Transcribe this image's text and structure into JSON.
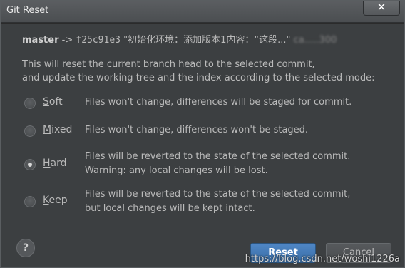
{
  "window": {
    "title": "Git Reset",
    "close_glyph": "✕"
  },
  "commit": {
    "branch": "master",
    "arrow": "->",
    "hash": "f25c91e3",
    "message": "\"初始化环境：添加版本1内容：“这段...\"",
    "blurred_tail": "ca.....300"
  },
  "description": {
    "line1": "This will reset the current branch head to the selected commit,",
    "line2": "and update the working tree and the index according to the selected mode:"
  },
  "modes": [
    {
      "mnemonic": "S",
      "rest": "oft",
      "line1": "Files won't change, differences will be staged for commit.",
      "line2": "",
      "selected": false
    },
    {
      "mnemonic": "M",
      "rest": "ixed",
      "line1": "Files won't change, differences won't be staged.",
      "line2": "",
      "selected": false
    },
    {
      "mnemonic": "H",
      "rest": "ard",
      "line1": "Files will be reverted to the state of the selected commit.",
      "line2": "Warning: any local changes will be lost.",
      "selected": true
    },
    {
      "mnemonic": "K",
      "rest": "eep",
      "line1": "Files will be reverted to the state of the selected commit,",
      "line2": "but local changes will be kept intact.",
      "selected": false
    }
  ],
  "buttons": {
    "help": "?",
    "reset": "Reset",
    "cancel": "Cancel"
  },
  "watermark": "https://blog.csdn.net/woshi1226a"
}
